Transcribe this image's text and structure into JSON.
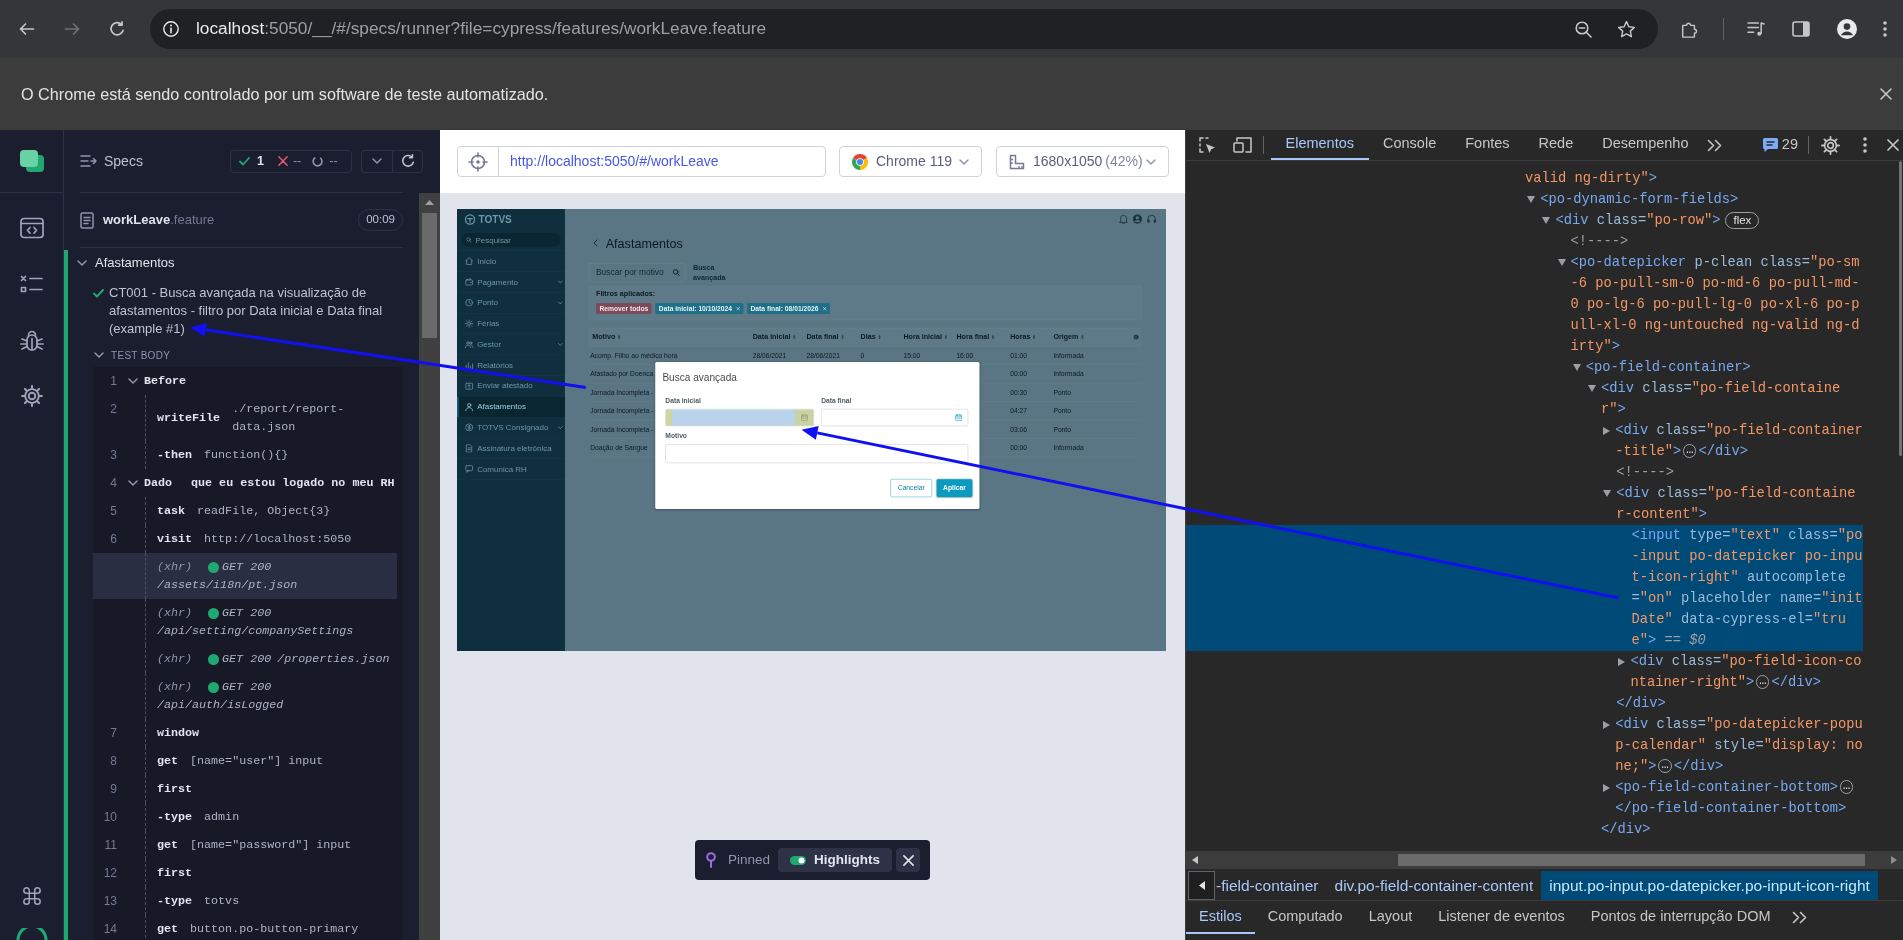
{
  "browser": {
    "nav_buttons": [
      {
        "kind": "back",
        "disabled": false
      },
      {
        "kind": "forward",
        "disabled": true
      },
      {
        "kind": "reload",
        "disabled": false
      }
    ],
    "url_host": "localhost",
    "url_path": ":5050/__/#/specs/runner?file=cypress/features/workLeave.feature"
  },
  "infobar": {
    "message": "O Chrome está sendo controlado por um software de teste automatizado."
  },
  "reporter": {
    "title": "Specs",
    "stats": {
      "passed": "1",
      "failed": "--",
      "pending": "--"
    },
    "spec": {
      "name": "workLeave",
      "extension": ".feature",
      "duration": "00:09"
    },
    "suite": {
      "title": "Afastamentos",
      "expanded": true,
      "test": {
        "title": "CT001 - Busca avançada na visualização de afastamentos - filtro por Data inicial e Data final (example #1)",
        "passed": true,
        "body": {
          "label": "TEST BODY",
          "expanded": true,
          "commands": [
            {
              "kind": "step",
              "number": "1",
              "name": "Before",
              "expanded": true,
              "children": [
                {
                  "kind": "command",
                  "number": "2",
                  "name": "writeFile",
                  "message": "./report/report-data.json",
                  "selected": false
                },
                {
                  "kind": "command",
                  "number": "3",
                  "name": "-then",
                  "message": "function(){}",
                  "selected": false
                }
              ]
            },
            {
              "kind": "step",
              "number": "4",
              "name": "Dado",
              "message": "que eu estou logado no meu RH",
              "expanded": true,
              "children": [
                {
                  "kind": "command",
                  "number": "5",
                  "name": "task",
                  "message": "readFile, Object{3}",
                  "selected": false
                },
                {
                  "kind": "command",
                  "number": "6",
                  "name": "visit",
                  "message": "http://localhost:5050",
                  "selected": false
                },
                {
                  "kind": "xhr",
                  "label": "(xhr)",
                  "status": "GET 200",
                  "path": "/assets/i18n/pt.json",
                  "selected": true
                },
                {
                  "kind": "xhr",
                  "label": "(xhr)",
                  "status": "GET 200",
                  "path": "/api/setting/companySettings",
                  "selected": false
                },
                {
                  "kind": "xhr",
                  "label": "(xhr)",
                  "status": "GET 200",
                  "path": "/properties.json",
                  "selected": false
                },
                {
                  "kind": "xhr",
                  "label": "(xhr)",
                  "status": "GET 200",
                  "path": "/api/auth/isLogged",
                  "selected": false
                },
                {
                  "kind": "command",
                  "number": "7",
                  "name": "window",
                  "selected": false
                },
                {
                  "kind": "command",
                  "number": "8",
                  "name": "get",
                  "message": "[name=\"user\"] input",
                  "selected": false
                },
                {
                  "kind": "command",
                  "number": "9",
                  "name": "first",
                  "selected": false
                },
                {
                  "kind": "command",
                  "number": "10",
                  "name": "-type",
                  "message": "admin",
                  "selected": false
                },
                {
                  "kind": "command",
                  "number": "11",
                  "name": "get",
                  "message": "[name=\"password\"] input",
                  "selected": false
                },
                {
                  "kind": "command",
                  "number": "12",
                  "name": "first",
                  "selected": false
                },
                {
                  "kind": "command",
                  "number": "13",
                  "name": "-type",
                  "message": "totvs",
                  "selected": false
                },
                {
                  "kind": "command",
                  "number": "14",
                  "name": "get",
                  "message": "button.po-button-primary",
                  "selected": false
                }
              ]
            }
          ]
        }
      }
    }
  },
  "runner": {
    "url": "http://localhost:5050/#/workLeave",
    "browser": "Chrome 119",
    "viewport": "1680x1050",
    "scale": "(42%)"
  },
  "app": {
    "logo": "TOTVS",
    "search_placeholder": "Pesquisar",
    "menu": [
      {
        "label": "Início",
        "expandable": false,
        "selected": false
      },
      {
        "label": "Pagamento",
        "expandable": true,
        "selected": false
      },
      {
        "label": "Ponto",
        "expandable": true,
        "selected": false
      },
      {
        "label": "Férias",
        "expandable": false,
        "selected": false
      },
      {
        "label": "Gestor",
        "expandable": true,
        "selected": false
      },
      {
        "label": "Relatórios",
        "expandable": false,
        "selected": false
      },
      {
        "label": "Enviar atestado",
        "expandable": false,
        "selected": false
      },
      {
        "label": "Afastamentos",
        "expandable": false,
        "selected": true
      },
      {
        "label": "TOTVS Consignado",
        "expandable": true,
        "selected": false
      },
      {
        "label": "Assinatura eletrônica",
        "expandable": false,
        "selected": false
      },
      {
        "label": "Comunica RH",
        "expandable": false,
        "selected": false
      }
    ],
    "page_title": "Afastamentos",
    "search": {
      "placeholder": "Buscar por motivo"
    },
    "advanced_search": "Busca avançada",
    "filters": {
      "label": "Filtros aplicados:",
      "remove_all": "Remover todos",
      "tags": [
        "Data inicial: 10/10/2024",
        "Data final: 08/01/2026"
      ]
    },
    "table": {
      "columns": [
        "Motivo",
        "Data inicial",
        "Data final",
        "Dias",
        "Hora inicial",
        "Hora final",
        "Horas",
        "Origem"
      ],
      "rows": [
        [
          "Acomp. Filho ao médico hora",
          "28/06/2021",
          "28/06/2021",
          "0",
          "15:00",
          "16:00",
          "01:00",
          "Informada"
        ],
        [
          "Afastado por Doenca",
          null,
          null,
          null,
          null,
          null,
          "00:00",
          "Informada"
        ],
        [
          "Jornada Incompleta -",
          null,
          null,
          null,
          null,
          null,
          "00:30",
          "Ponto"
        ],
        [
          "Jornada Incompleta -",
          null,
          null,
          null,
          null,
          null,
          "04:27",
          "Ponto"
        ],
        [
          "Jornada Incompleta -",
          null,
          null,
          null,
          null,
          null,
          "03:06",
          "Ponto"
        ],
        [
          "Doação de Sangue",
          null,
          null,
          null,
          null,
          null,
          "00:00",
          "Informada"
        ]
      ]
    },
    "dialog": {
      "title": "Busca avançada",
      "fields": [
        {
          "label": "Data inicial",
          "kind": "date",
          "highlighted": true
        },
        {
          "label": "Data final",
          "kind": "date",
          "highlighted": false
        },
        {
          "label": "Motivo",
          "kind": "text",
          "highlighted": false
        }
      ],
      "buttons": [
        {
          "label": "Cancelar",
          "kind": "secondary"
        },
        {
          "label": "Aplicar",
          "kind": "primary"
        }
      ]
    }
  },
  "pinned_bar": {
    "label": "Pinned",
    "highlights": {
      "label": "Highlights",
      "on": true
    }
  },
  "devtools": {
    "tabs": [
      {
        "label": "Elementos",
        "selected": true
      },
      {
        "label": "Console",
        "selected": false
      },
      {
        "label": "Fontes",
        "selected": false
      },
      {
        "label": "Rede",
        "selected": false
      },
      {
        "label": "Desempenho",
        "selected": false
      }
    ],
    "issues": "29",
    "dom": [
      {
        "segments": [
          {
            "kind": "value",
            "text": "valid ng-dirty\""
          },
          {
            "kind": "tag",
            "text": ">"
          }
        ],
        "selected": false,
        "children": [
          {
            "segments": [
              {
                "kind": "tag",
                "text": "<po-dynamic-form-fields>"
              }
            ],
            "expanded": true,
            "selected": false,
            "children": [
              {
                "segments": [
                  {
                    "kind": "tag",
                    "text": "<div"
                  },
                  {
                    "kind": "attr",
                    "text": " class="
                  },
                  {
                    "kind": "value",
                    "text": "\"po-row\""
                  },
                  {
                    "kind": "tag",
                    "text": ">"
                  }
                ],
                "badge": "flex",
                "expanded": true,
                "selected": false,
                "children": [
                  {
                    "segments": [
                      {
                        "kind": "comment",
                        "text": "<!---->"
                      }
                    ],
                    "selected": false
                  },
                  {
                    "segments": [
                      {
                        "kind": "tag",
                        "text": "<po-datepicker"
                      },
                      {
                        "kind": "attr",
                        "text": " p-clean class="
                      },
                      {
                        "kind": "value",
                        "text": "\"po-sm-6 po-pull-sm-0 po-md-6 po-pull-md-0 po-lg-6 po-pull-lg-0 po-xl-6 po-pull-xl-0 ng-untouched ng-valid ng-dirty\""
                      },
                      {
                        "kind": "tag",
                        "text": ">"
                      }
                    ],
                    "expanded": true,
                    "selected": false,
                    "children": [
                      {
                        "segments": [
                          {
                            "kind": "tag",
                            "text": "<po-field-container>"
                          }
                        ],
                        "expanded": true,
                        "selected": false,
                        "children": [
                          {
                            "segments": [
                              {
                                "kind": "tag",
                                "text": "<div"
                              },
                              {
                                "kind": "attr",
                                "text": " class="
                              },
                              {
                                "kind": "value",
                                "text": "\"po-field-container\""
                              },
                              {
                                "kind": "tag",
                                "text": ">"
                              }
                            ],
                            "expanded": true,
                            "selected": false,
                            "children": [
                              {
                                "segments": [
                                  {
                                    "kind": "tag",
                                    "text": "<div"
                                  },
                                  {
                                    "kind": "attr",
                                    "text": " class="
                                  },
                                  {
                                    "kind": "value",
                                    "text": "\"po-field-container-title\""
                                  },
                                  {
                                    "kind": "tag",
                                    "text": ">"
                                  },
                                  {
                                    "kind": "ellipsis",
                                    "text": "…"
                                  },
                                  {
                                    "kind": "tag",
                                    "text": "</div>"
                                  }
                                ],
                                "expanded": false,
                                "selected": false
                              },
                              {
                                "segments": [
                                  {
                                    "kind": "comment",
                                    "text": "<!---->"
                                  }
                                ],
                                "selected": false
                              },
                              {
                                "segments": [
                                  {
                                    "kind": "tag",
                                    "text": "<div"
                                  },
                                  {
                                    "kind": "attr",
                                    "text": " class="
                                  },
                                  {
                                    "kind": "value",
                                    "text": "\"po-field-container-content\""
                                  },
                                  {
                                    "kind": "tag",
                                    "text": ">"
                                  }
                                ],
                                "expanded": true,
                                "selected": false,
                                "children": [
                                  {
                                    "segments": [
                                      {
                                        "kind": "tag",
                                        "text": "<input"
                                      },
                                      {
                                        "kind": "attr",
                                        "text": " type="
                                      },
                                      {
                                        "kind": "value",
                                        "text": "\"text\""
                                      },
                                      {
                                        "kind": "attr",
                                        "text": " class="
                                      },
                                      {
                                        "kind": "value",
                                        "text": "\"po-input po-datepicker po-input-icon-right\""
                                      },
                                      {
                                        "kind": "attr",
                                        "text": " autocomplete="
                                      },
                                      {
                                        "kind": "value",
                                        "text": "\"on\""
                                      },
                                      {
                                        "kind": "attr",
                                        "text": " placeholder name="
                                      },
                                      {
                                        "kind": "value",
                                        "text": "\"initDate\""
                                      },
                                      {
                                        "kind": "attr",
                                        "text": " data-cypress-el="
                                      },
                                      {
                                        "kind": "value",
                                        "text": "\"true\""
                                      },
                                      {
                                        "kind": "tag",
                                        "text": ">"
                                      },
                                      {
                                        "kind": "note",
                                        "text": " == $0"
                                      }
                                    ],
                                    "selected": true
                                  },
                                  {
                                    "segments": [
                                      {
                                        "kind": "tag",
                                        "text": "<div"
                                      },
                                      {
                                        "kind": "attr",
                                        "text": " class="
                                      },
                                      {
                                        "kind": "value",
                                        "text": "\"po-field-icon-container-right\""
                                      },
                                      {
                                        "kind": "tag",
                                        "text": ">"
                                      },
                                      {
                                        "kind": "ellipsis",
                                        "text": "…"
                                      },
                                      {
                                        "kind": "tag",
                                        "text": "</div>"
                                      }
                                    ],
                                    "expanded": false,
                                    "selected": false
                                  }
                                ],
                                "closing": [
                                  {
                                    "kind": "tag",
                                    "text": "</div>"
                                  }
                                ]
                              },
                              {
                                "segments": [
                                  {
                                    "kind": "tag",
                                    "text": "<div"
                                  },
                                  {
                                    "kind": "attr",
                                    "text": " class="
                                  },
                                  {
                                    "kind": "value",
                                    "text": "\"po-datepicker-popup-calendar\""
                                  },
                                  {
                                    "kind": "attr",
                                    "text": " style="
                                  },
                                  {
                                    "kind": "value",
                                    "text": "\"display: none;\""
                                  },
                                  {
                                    "kind": "tag",
                                    "text": ">"
                                  },
                                  {
                                    "kind": "ellipsis",
                                    "text": "…"
                                  },
                                  {
                                    "kind": "tag",
                                    "text": "</div>"
                                  }
                                ],
                                "expanded": false,
                                "selected": false
                              },
                              {
                                "segments": [
                                  {
                                    "kind": "tag",
                                    "text": "<po-field-container-bottom>"
                                  },
                                  {
                                    "kind": "ellipsis",
                                    "text": "…"
                                  },
                                  {
                                    "kind": "tag",
                                    "text": "</po-field-container-bottom>"
                                  }
                                ],
                                "expanded": false,
                                "selected": false
                              }
                            ],
                            "closing": [
                              {
                                "kind": "tag",
                                "text": "</div>"
                              }
                            ]
                          }
                        ]
                      }
                    ]
                  }
                ]
              }
            ]
          }
        ]
      }
    ],
    "breadcrumbs": [
      {
        "label": "-field-container",
        "selected": false
      },
      {
        "label": "div.po-field-container-content",
        "selected": false
      },
      {
        "label": "input.po-input.po-datepicker.po-input-icon-right",
        "selected": true
      }
    ],
    "bottom_tabs": [
      {
        "label": "Estilos",
        "selected": true
      },
      {
        "label": "Computado",
        "selected": false
      },
      {
        "label": "Layout",
        "selected": false
      },
      {
        "label": "Listener de eventos",
        "selected": false
      },
      {
        "label": "Pontos de interrupção DOM",
        "selected": false
      }
    ]
  }
}
